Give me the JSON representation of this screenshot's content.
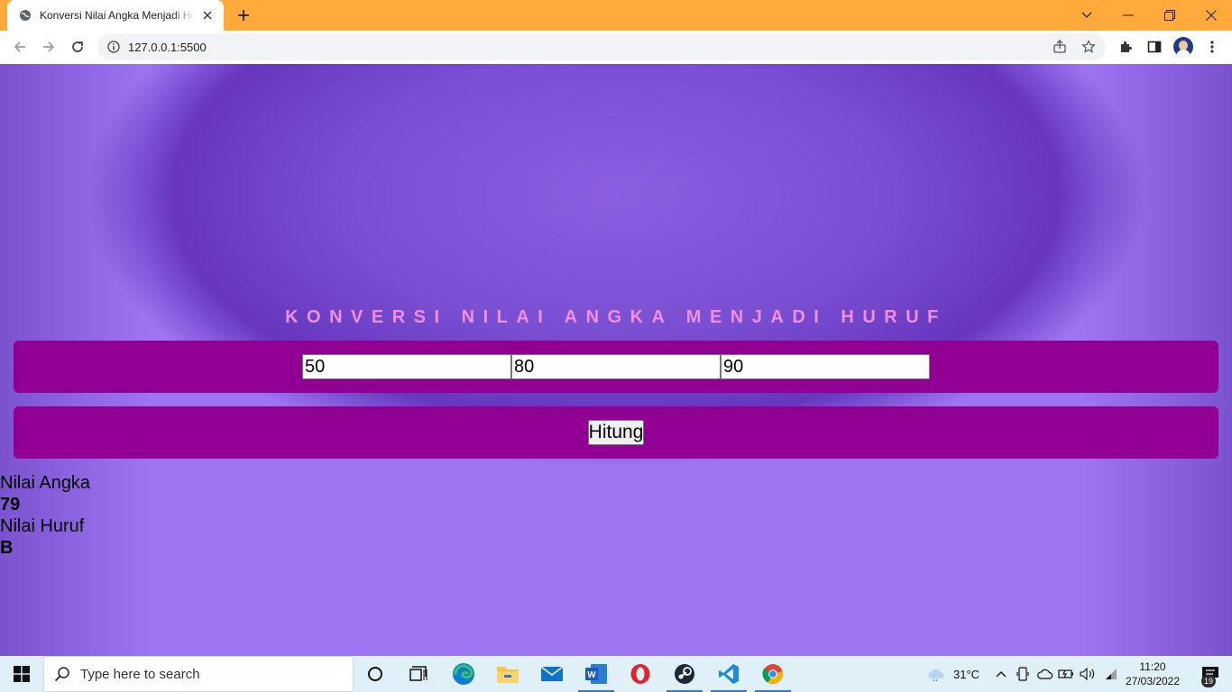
{
  "browser": {
    "tab_title": "Konversi Nilai Angka Menjadi Huruf",
    "url": "127.0.0.1:5500"
  },
  "page": {
    "title": "KONVERSI NILAI ANGKA MENJADI HURUF",
    "inputs": [
      "50",
      "80",
      "90"
    ],
    "button_label": "Hitung",
    "result": {
      "numeric_label": "Nilai Angka",
      "numeric_value": "79",
      "letter_label": "Nilai Huruf",
      "letter_value": "B"
    }
  },
  "taskbar": {
    "search_placeholder": "Type here to search",
    "apps": [
      "cortana-icon",
      "task-view-icon",
      "edge-icon",
      "file-explorer-icon",
      "mail-icon",
      "word-icon",
      "opera-icon",
      "steam-icon",
      "vscode-icon",
      "chrome-icon"
    ],
    "weather": "31°C",
    "time": "11:20",
    "date": "27/03/2022",
    "notification_count": "19"
  },
  "colors": {
    "titlebar": "#ffaa3b",
    "band": "#910093",
    "heading": "#f08fe0",
    "page_bg": "#9d74f2"
  }
}
